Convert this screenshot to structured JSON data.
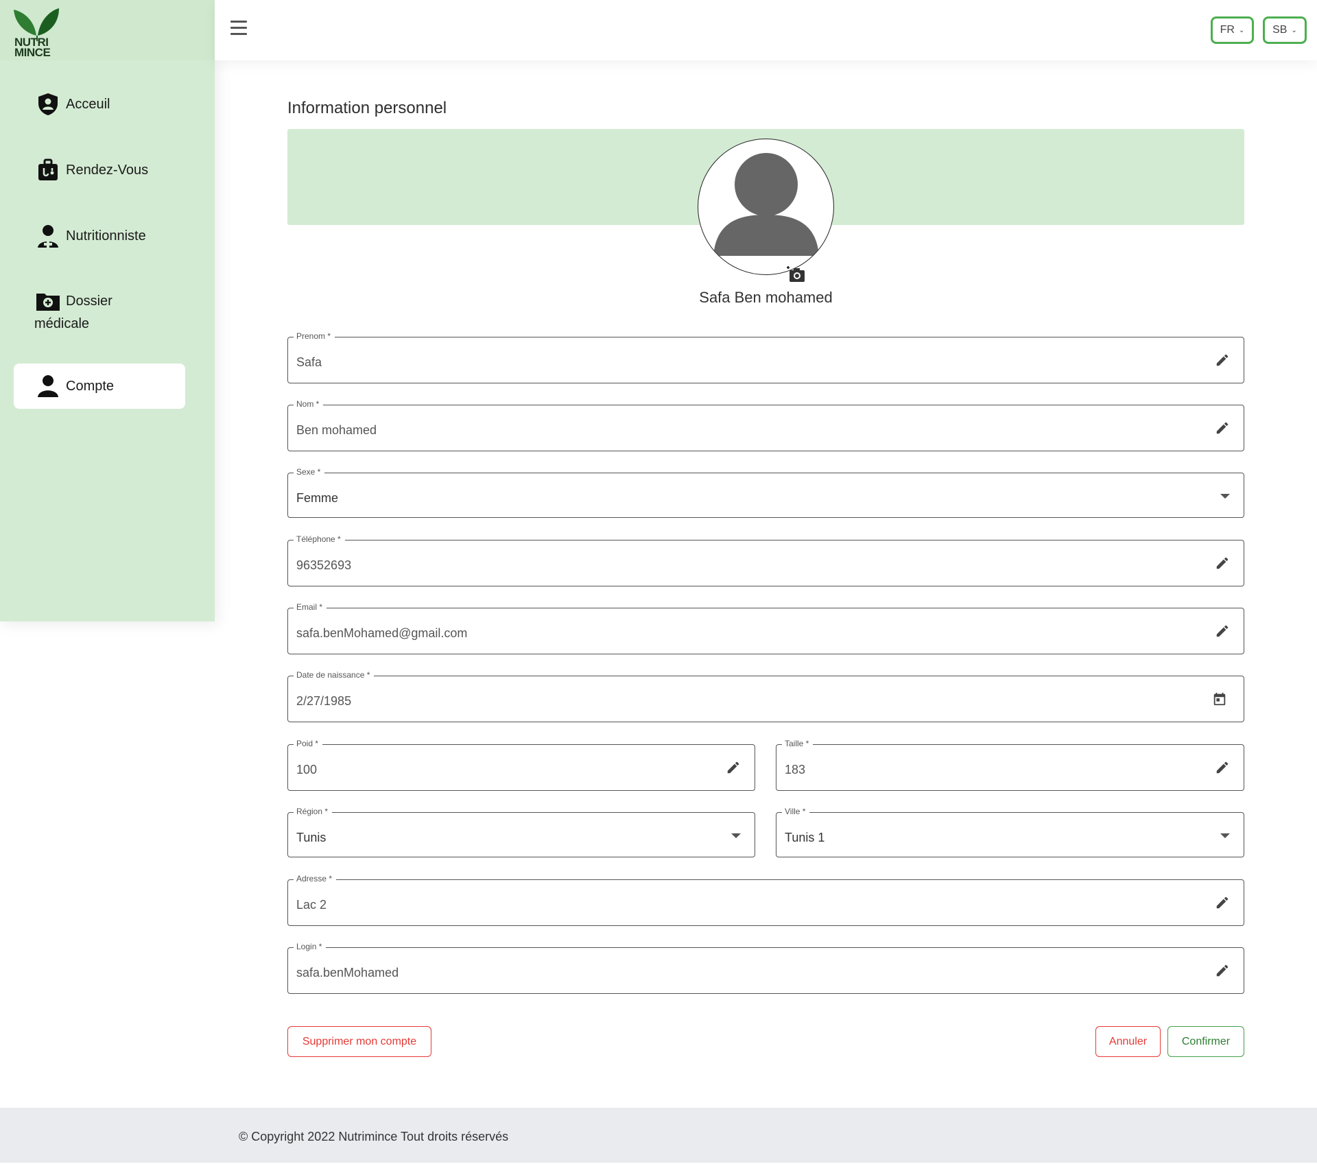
{
  "brand": {
    "logo_line1": "NUTRI",
    "logo_line2": "MINCE",
    "accent": "#4caf50",
    "sidebar_bg": "#d4ebd3"
  },
  "sidebar": {
    "items": [
      {
        "label": "Acceuil",
        "icon": "shield-user-icon"
      },
      {
        "label": "Rendez-Vous",
        "icon": "medical-bag-icon"
      },
      {
        "label": "Nutritionniste",
        "icon": "doctor-icon"
      },
      {
        "label_line1": "Dossier",
        "label_line2": "médicale",
        "icon": "folder-plus-icon"
      },
      {
        "label": "Compte",
        "icon": "user-icon",
        "active": true
      }
    ]
  },
  "header": {
    "language": "FR",
    "user_initials": "SB"
  },
  "main": {
    "title": "Information personnel",
    "profile_name": "Safa Ben mohamed",
    "fields": {
      "prenom": {
        "label": "Prenom *",
        "value": "Safa"
      },
      "nom": {
        "label": "Nom *",
        "value": "Ben mohamed"
      },
      "sexe": {
        "label": "Sexe *",
        "value": "Femme"
      },
      "telephone": {
        "label": "Téléphone *",
        "value": "96352693"
      },
      "email": {
        "label": "Email *",
        "value": "safa.benMohamed@gmail.com"
      },
      "naissance": {
        "label": "Date de naissance *",
        "value": "2/27/1985"
      },
      "poid": {
        "label": "Poid *",
        "value": "100"
      },
      "taille": {
        "label": "Taille *",
        "value": "183"
      },
      "region": {
        "label": "Région *",
        "value": "Tunis"
      },
      "ville": {
        "label": "Ville *",
        "value": "Tunis 1"
      },
      "adresse": {
        "label": "Adresse *",
        "value": "Lac 2"
      },
      "login": {
        "label": "Login *",
        "value": "safa.benMohamed"
      }
    },
    "buttons": {
      "delete": "Supprimer mon compte",
      "cancel": "Annuler",
      "confirm": "Confirmer"
    }
  },
  "footer": {
    "text": "© Copyright 2022 Nutrimince Tout droits réservés"
  }
}
